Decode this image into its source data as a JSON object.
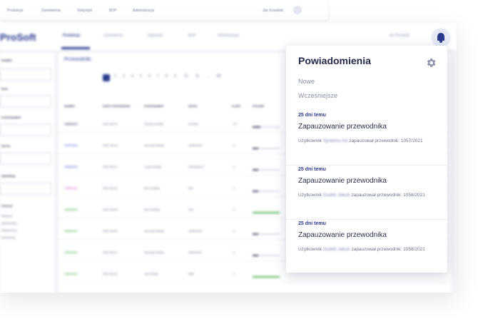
{
  "back_nav": {
    "items": [
      "Produkcja",
      "Zamówienia",
      "Statystyki",
      "BOP",
      "Administracja"
    ],
    "user": "Jan Kowalski"
  },
  "app": {
    "logo": "ProSoft",
    "nav": [
      "Produkcja",
      "Zamówienia",
      "Statystyki",
      "BOP",
      "Administracja"
    ],
    "user": "Jan Kowalski",
    "page_title": "Przewodniki",
    "pagination": [
      "1",
      "2",
      "3",
      "4",
      "5",
      "6",
      "7",
      "8",
      "9",
      "10",
      "11",
      "...",
      "89"
    ],
    "table_headers": [
      "NUMER",
      "DATA UTWORZENIA",
      "KONTRAHENT",
      "DETAL",
      "ILOŚĆ",
      "POSTĘP"
    ],
    "rows": [
      {
        "num": "1058/2021",
        "date": "2021-08-13",
        "client": "Tomasz Nowak",
        "detail": "W-7834",
        "qty": "20",
        "color": "#3a3f5c",
        "progress": 0.3
      },
      {
        "num": "1057/2021",
        "date": "2021-08-13",
        "client": "Szczotki Polska",
        "detail": "VARIO200",
        "qty": "5",
        "color": "#5b6bd6",
        "progress": 0.2
      },
      {
        "num": "1056/2021",
        "date": "2021-08-20",
        "client": "Lucas Nowak",
        "detail": "Wentylator F",
        "qty": "4",
        "color": "#5b6bd6",
        "progress": 0.2
      },
      {
        "num": "1055/2021",
        "date": "2021-08-20",
        "client": "Bez Ozdoby",
        "detail": "Płot",
        "qty": "5",
        "color": "#d86fd0",
        "progress": 0.2
      },
      {
        "num": "1054/2021",
        "date": "2021-08-20",
        "client": "Bez Ozdoby",
        "detail": "Płot",
        "qty": "5",
        "color": "#4caf50",
        "progress": 1.0
      },
      {
        "num": "1053/2021",
        "date": "2021-08-20",
        "client": "Szczotki Polska",
        "detail": "VARIO200",
        "qty": "2",
        "color": "#4caf50",
        "progress": 0.2
      },
      {
        "num": "1052/2021",
        "date": "2021-08-20",
        "client": "Szczotki Polska",
        "detail": "VARIO200",
        "qty": "5",
        "color": "#4caf50",
        "progress": 0.2
      },
      {
        "num": "1051/2021",
        "date": "2021-08-20",
        "client": "Jan Nowak",
        "detail": "M56",
        "qty": "5",
        "color": "#4caf50",
        "progress": 1.0
      }
    ]
  },
  "notifications": {
    "title": "Powiadomienia",
    "settings_icon": "gear-icon",
    "tabs": [
      "Nowe",
      "Wcześniejsze"
    ],
    "items": [
      {
        "time": "25 dni temu",
        "title": "Zapauzowanie przewodnika",
        "prefix": "Użytkownik",
        "user": "Systemu Ad",
        "suffix": "zapauzował przewodnik:",
        "ref": "1057/2021"
      },
      {
        "time": "25 dni temu",
        "title": "Zapauzowanie przewodnika",
        "prefix": "Użytkownik",
        "user": "Dudek Jakub",
        "suffix": "zapauzował przewodnik:",
        "ref": "1058/2021"
      },
      {
        "time": "25 dni temu",
        "title": "Zapauzowanie przewodnika",
        "prefix": "Użytkownik",
        "user": "Dudek Jakub",
        "suffix": "zapauzował przewodnik:",
        "ref": "1058/2021"
      }
    ]
  },
  "colors": {
    "accent": "#2b3a8f",
    "panel_bg": "#ffffff",
    "page_bg": "#f3f4f8"
  }
}
